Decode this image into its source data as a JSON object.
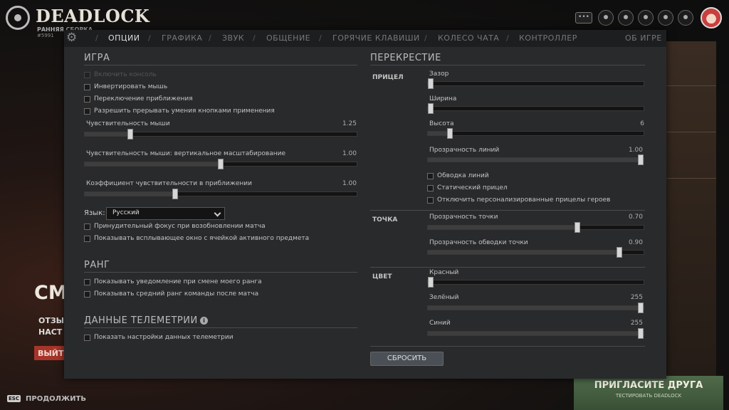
{
  "brand": {
    "name": "DEADLOCK",
    "subtitle": "РАННЯЯ СБОРКА",
    "version": "#5991"
  },
  "topbar": {
    "chat_icon": "•••"
  },
  "background": {
    "big_text": "СМ",
    "line1": "ОТЗЫ",
    "line2": "НАСТ",
    "button": "ВЫЙТ"
  },
  "invite": {
    "title": "ПРИГЛАСИТЕ ДРУГА",
    "subtitle": "ТЕСТИРОВАТЬ DEADLOCK"
  },
  "footer": {
    "esc_key": "ESC",
    "continue_label": "ПРОДОЛЖИТЬ"
  },
  "tabs": [
    "ОПЦИИ",
    "ГРАФИКА",
    "ЗВУК",
    "ОБЩЕНИЕ",
    "ГОРЯЧИЕ КЛАВИШИ",
    "КОЛЕСО ЧАТА",
    "КОНТРОЛЛЕР"
  ],
  "about_tab": "ОБ ИГРЕ",
  "game": {
    "header": "ИГРА",
    "checkboxes": [
      "Включить консоль",
      "Инвертировать мышь",
      "Переключение приближения",
      "Разрешить прерывать умения кнопками применения"
    ],
    "sliders": [
      {
        "label": "Чувствительность мыши",
        "value": "1.25",
        "fraction": 0.16
      },
      {
        "label": "Чувствительность мыши: вертикальное масштабирование",
        "value": "1.00",
        "fraction": 0.5
      },
      {
        "label": "Коэффициент чувствительности в приближении",
        "value": "1.00",
        "fraction": 0.33
      }
    ],
    "language_label": "Язык:",
    "language_value": "Русский",
    "checkboxes2": [
      "Принудительный фокус при возобновлении матча",
      "Показывать всплывающее окно с ячейкой активного предмета"
    ]
  },
  "rank": {
    "header": "РАНГ",
    "checkboxes": [
      "Показывать уведомление при смене моего ранга",
      "Показывать средний ранг команды после матча"
    ]
  },
  "telemetry": {
    "header": "ДАННЫЕ ТЕЛЕМЕТРИИ",
    "info_icon": "i",
    "checkbox": "Показать настройки данных телеметрии"
  },
  "crosshair": {
    "header": "ПЕРЕКРЕСТИЕ",
    "reticle_label": "ПРИЦЕЛ",
    "reticle_sliders": [
      {
        "label": "Зазор",
        "value": "",
        "fraction": 0
      },
      {
        "label": "Ширина",
        "value": "",
        "fraction": 0
      },
      {
        "label": "Высота",
        "value": "6",
        "fraction": 0.09
      },
      {
        "label": "Прозрачность линий",
        "value": "1.00",
        "fraction": 1
      }
    ],
    "reticle_checkboxes": [
      "Обводка линий",
      "Статический прицел",
      "Отключить персонализированные прицелы героев"
    ],
    "dot_label": "ТОЧКА",
    "dot_sliders": [
      {
        "label": "Прозрачность точки",
        "value": "0.70",
        "fraction": 0.7
      },
      {
        "label": "Прозрачность обводки точки",
        "value": "0.90",
        "fraction": 0.9
      }
    ],
    "color_label": "ЦВЕТ",
    "color_sliders": [
      {
        "label": "Красный",
        "value": "",
        "fraction": 0
      },
      {
        "label": "Зелёный",
        "value": "255",
        "fraction": 1
      },
      {
        "label": "Синий",
        "value": "255",
        "fraction": 1
      }
    ],
    "reset_button": "СБРОСИТЬ"
  }
}
